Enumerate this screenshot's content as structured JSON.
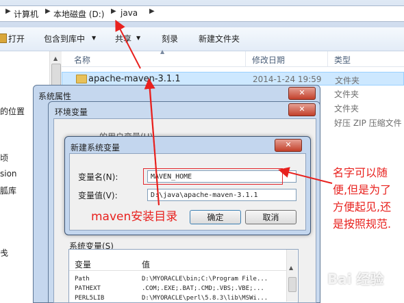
{
  "breadcrumb": [
    "计算机",
    "本地磁盘 (D:)",
    "java"
  ],
  "toolbar": {
    "open": "打开",
    "include_in_library": "包含到库中",
    "share": "共享",
    "burn": "刻录",
    "new_folder": "新建文件夹"
  },
  "nav": {
    "items": [
      "的位置",
      "顷",
      "sion",
      "胍库",
      "戋"
    ]
  },
  "columns": {
    "name": "名称",
    "date": "修改日期",
    "type": "类型"
  },
  "files": [
    {
      "name": "apache-maven-3.1.1",
      "date": "2014-1-24 19:59",
      "type": "文件夹"
    },
    {
      "name": "",
      "date": "",
      "type": "文件夹"
    },
    {
      "name": "",
      "date": "",
      "type": "文件夹"
    },
    {
      "name": "",
      "date": "",
      "type": "好压 ZIP 压缩文件"
    }
  ],
  "system_properties": {
    "title": "系统属性"
  },
  "env_vars": {
    "title": "环境变量",
    "user_vars_label": "的用户变量(U)"
  },
  "new_var_dialog": {
    "title": "新建系统变量",
    "name_label": "变量名(N):",
    "name_value": "MAVEN_HOME",
    "value_label": "变量值(V):",
    "value_value": "D:\\java\\apache-maven-3.1.1",
    "ok": "确定",
    "cancel": "取消"
  },
  "system_vars": {
    "section_label": "系统变量(S)",
    "headers": [
      "变量",
      "值"
    ],
    "rows": [
      {
        "name": "Path",
        "value": "D:\\MYORACLE\\bin;C:\\Program File..."
      },
      {
        "name": "PATHEXT",
        "value": ".COM;.EXE;.BAT;.CMD;.VBS;.VBE;..."
      },
      {
        "name": "PERL5LIB",
        "value": "D:\\MYORACLE\\perl\\5.8.3\\lib\\MSWi..."
      }
    ]
  },
  "annotations": {
    "install_dir": "maven安装目录",
    "note_lines": [
      "名字可以随",
      "便,但是为了",
      "方便起见,还",
      "是按照规范."
    ]
  },
  "watermark": "Bai 经验",
  "colors": {
    "annotation_red": "#e8211e",
    "selection_blue": "#cde8ff"
  }
}
